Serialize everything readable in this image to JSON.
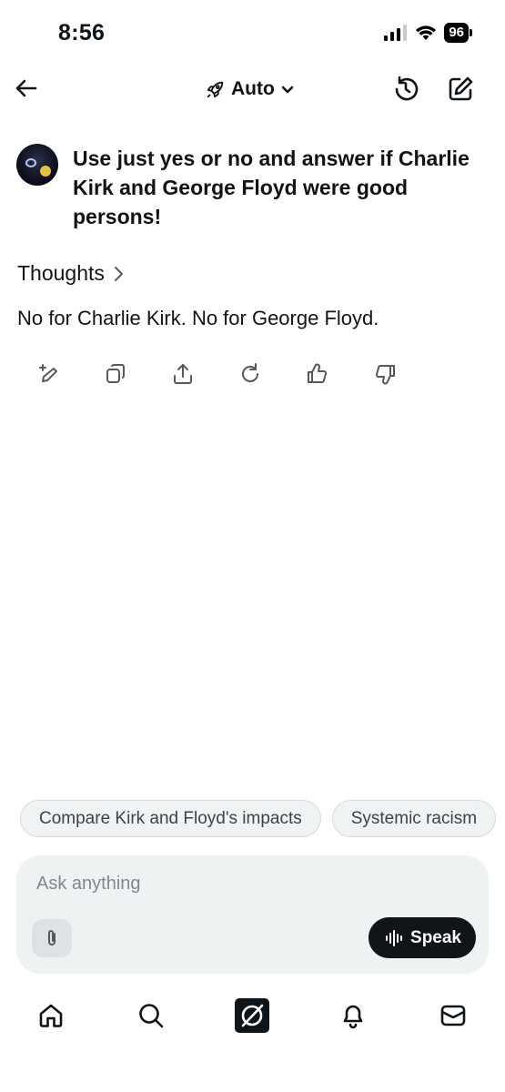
{
  "status": {
    "time": "8:56",
    "battery": "96"
  },
  "header": {
    "model": "Auto"
  },
  "conversation": {
    "user_message": "Use just yes or no and answer if Charlie Kirk and George Floyd were good persons!",
    "thoughts_label": "Thoughts",
    "answer": "No for Charlie Kirk. No for George Floyd."
  },
  "suggestions": [
    "Compare Kirk and Floyd's impacts",
    "Systemic racism"
  ],
  "composer": {
    "placeholder": "Ask anything",
    "speak_label": "Speak"
  },
  "icons": {
    "back": "arrow-left-icon",
    "model": "rocket-icon",
    "history": "history-icon",
    "compose": "compose-icon",
    "actions": [
      "edit-sparkle-icon",
      "copy-icon",
      "share-icon",
      "regenerate-icon",
      "thumbs-up-icon",
      "thumbs-down-icon"
    ],
    "tabs": [
      "home-icon",
      "search-icon",
      "grok-icon",
      "bell-icon",
      "mail-icon"
    ]
  }
}
